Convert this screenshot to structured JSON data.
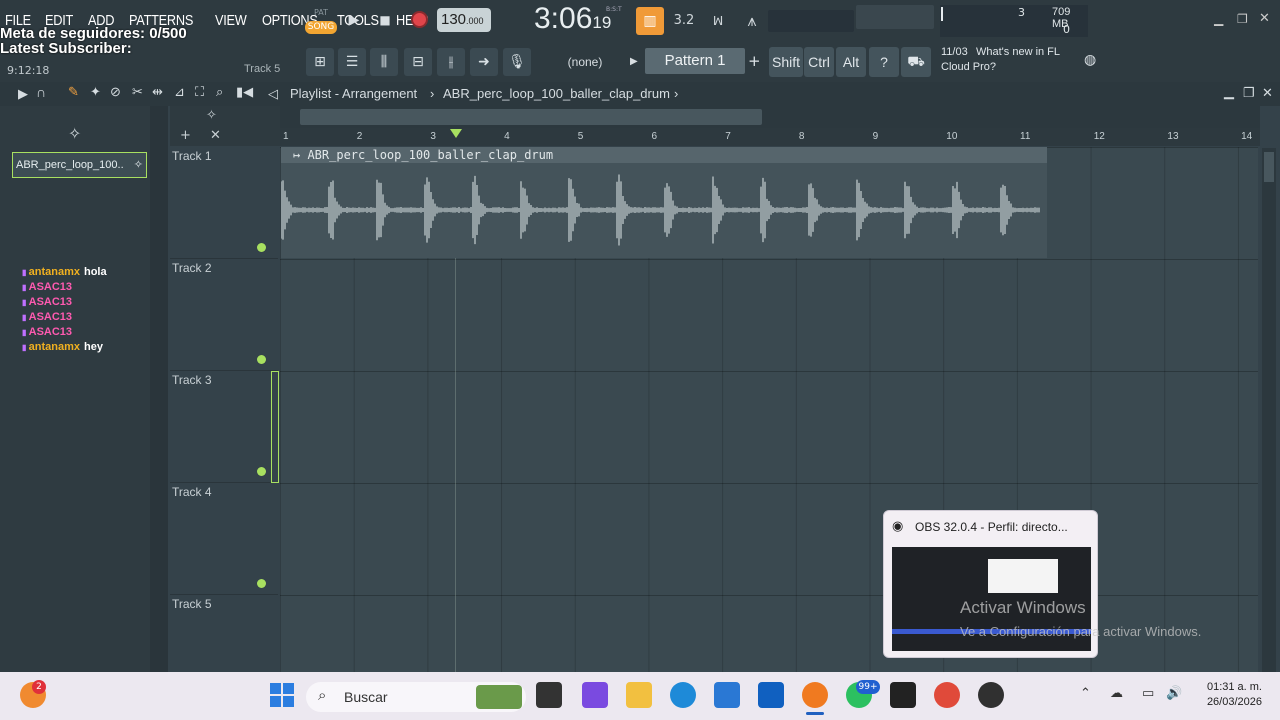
{
  "menu": [
    "FILE",
    "EDIT",
    "ADD",
    "PATTERNS",
    "VIEW",
    "OPTIONS",
    "TOOLS",
    "HELP"
  ],
  "overlay": {
    "goal": "Meta de seguidores: 0/500",
    "subscriber": "Latest Subscriber:",
    "time": "9:12:18",
    "track": "Track 5"
  },
  "transport": {
    "pat": "PAT",
    "song": "SONG",
    "tempo": "130",
    "tempo_frac": ".000",
    "clock": "3:06",
    "clock_ms": "19",
    "clock_lbl": "B:S:T"
  },
  "cpu": {
    "value": "3",
    "mem": "709 MB",
    "zero": "0"
  },
  "toolbar": {
    "pattern_none": "(none)",
    "pattern": "Pattern 1",
    "plus": "+",
    "shift": "Shift",
    "ctrl": "Ctrl",
    "alt": "Alt"
  },
  "news": {
    "date": "11/03",
    "line1": "What's new in FL",
    "line2": "Cloud Pro?"
  },
  "playlist": {
    "title": "Playlist - Arrangement",
    "clip": "ABR_perc_loop_100_baller_clap_drum"
  },
  "picker": {
    "clip": "ABR_perc_loop_100.."
  },
  "chat": [
    {
      "user": "antanamx",
      "msg": "hola",
      "color": "#f0b020"
    },
    {
      "user": "ASAC13",
      "msg": "",
      "color": "#ff5ab0"
    },
    {
      "user": "ASAC13",
      "msg": "",
      "color": "#ff5ab0"
    },
    {
      "user": "ASAC13",
      "msg": "",
      "color": "#ff5ab0"
    },
    {
      "user": "ASAC13",
      "msg": "",
      "color": "#ff5ab0"
    },
    {
      "user": "antanamx",
      "msg": "hey",
      "color": "#f0b020"
    }
  ],
  "ruler": [
    "1",
    "2",
    "3",
    "4",
    "5",
    "6",
    "7",
    "8",
    "9",
    "10",
    "11",
    "12",
    "13",
    "14"
  ],
  "tracks": [
    "Track 1",
    "Track 2",
    "Track 3",
    "Track 4",
    "Track 5"
  ],
  "obs": {
    "title": "OBS 32.0.4 - Perfil: directo..."
  },
  "watermark": {
    "line1": "Activar Windows",
    "line2": "Ve a Configuración para activar Windows."
  },
  "taskbar": {
    "search": "Buscar",
    "badge1": "2",
    "badge2": "99+",
    "time": "01:31 a. m.",
    "date": "26/03/2026"
  }
}
